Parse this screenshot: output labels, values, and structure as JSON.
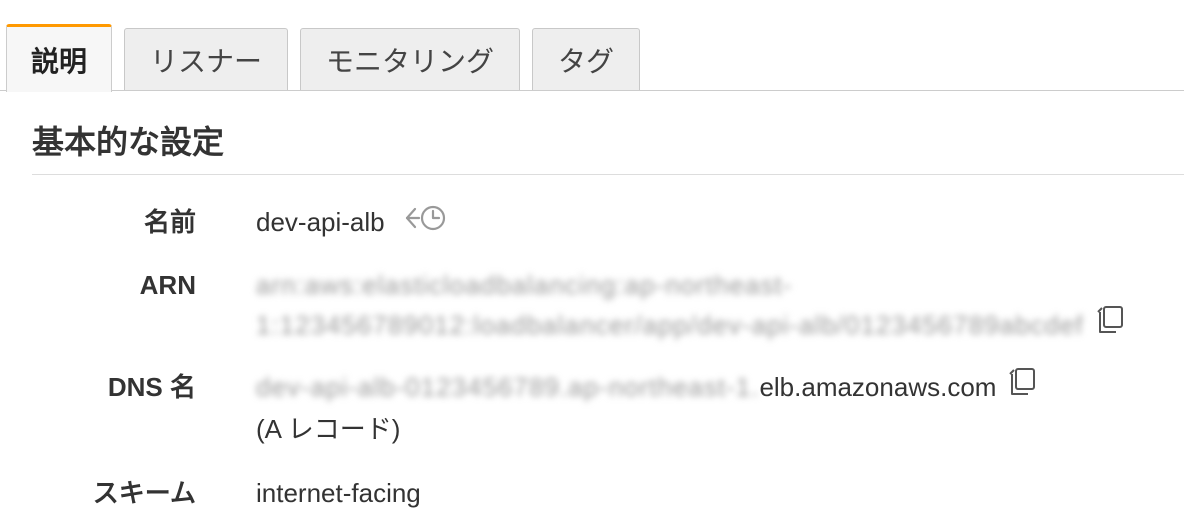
{
  "tabs": [
    {
      "label": "説明",
      "active": true
    },
    {
      "label": "リスナー",
      "active": false
    },
    {
      "label": "モニタリング",
      "active": false
    },
    {
      "label": "タグ",
      "active": false
    }
  ],
  "section": {
    "title": "基本的な設定"
  },
  "fields": {
    "name": {
      "label": "名前",
      "value": "dev-api-alb"
    },
    "arn": {
      "label": "ARN",
      "line1": "arn:aws:elasticloadbalancing:ap-northeast-",
      "line2": "1:123456789012:loadbalancer/app/dev-api-alb/0123456789abcdef"
    },
    "dns": {
      "label": "DNS 名",
      "value_prefix": "dev-api-alb-0123456789.ap-northeast-1.",
      "value_suffix": "elb.amazonaws.com",
      "record_type": "(A レコード)"
    },
    "scheme": {
      "label": "スキーム",
      "value": "internet-facing"
    }
  },
  "icons": {
    "history": "history-icon",
    "copy": "copy-icon"
  },
  "colors": {
    "active_tab_accent": "#ff9900",
    "tab_background": "#eeeeee",
    "text": "#333333"
  }
}
